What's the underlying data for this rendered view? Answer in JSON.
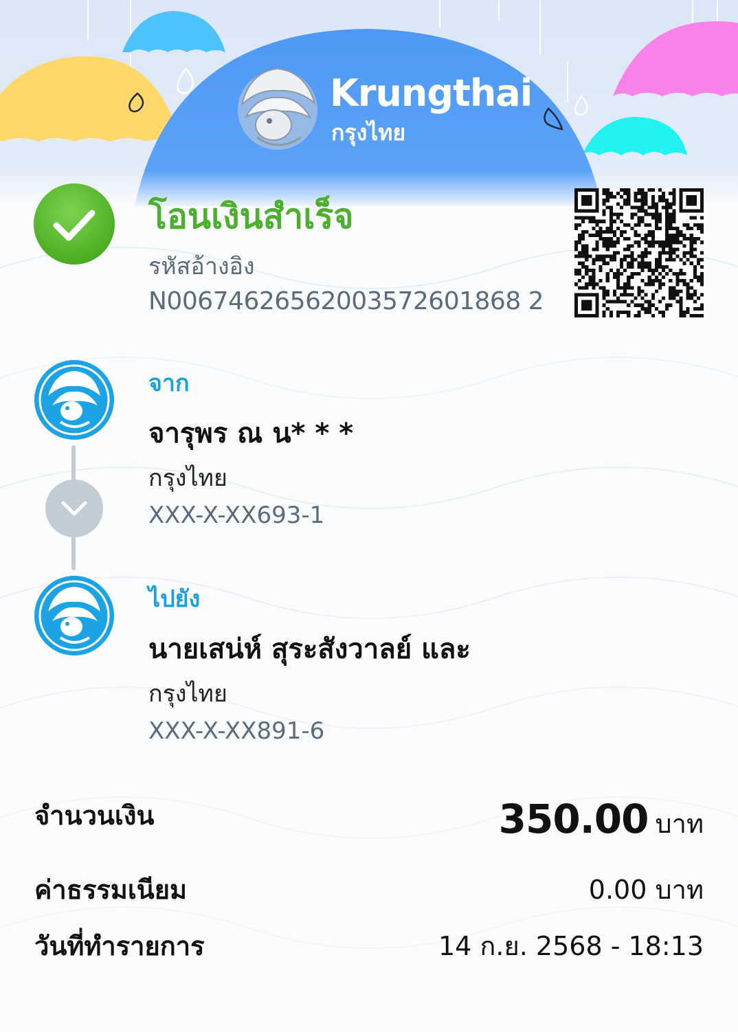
{
  "header": {
    "brand_en": "Krungthai",
    "brand_th": "กรุงไทย",
    "colors": {
      "sky": "#dce8f8",
      "dome": "#569ef7",
      "umbrella_yellow": "#ffd769",
      "umbrella_blue": "#4ec4fb",
      "umbrella_pink": "#fa80ea",
      "umbrella_cyan": "#1ff4f2"
    }
  },
  "status": {
    "title": "โอนเงินสำเร็จ",
    "icon": "check-circle-icon",
    "color": "#4caf2e"
  },
  "reference": {
    "label": "รหัสอ้างอิง",
    "value": "N00674626562003572601868 2"
  },
  "from": {
    "label": "จาก",
    "name": "จารุพร ณ น* * *",
    "bank": "กรุงไทย",
    "account": "XXX-X-XX693-1"
  },
  "to": {
    "label": "ไปยัง",
    "name": "นายเสน่ห์ สุระสังวาลย์ และ",
    "bank": "กรุงไทย",
    "account": "XXX-X-XX891-6"
  },
  "amount": {
    "label": "จำนวนเงิน",
    "value": "350.00",
    "unit": "บาท"
  },
  "fee": {
    "label": "ค่าธรรมเนียม",
    "value": "0.00 บาท"
  },
  "date": {
    "label": "วันที่ทำรายการ",
    "value": "14 ก.ย. 2568 - 18:13"
  }
}
